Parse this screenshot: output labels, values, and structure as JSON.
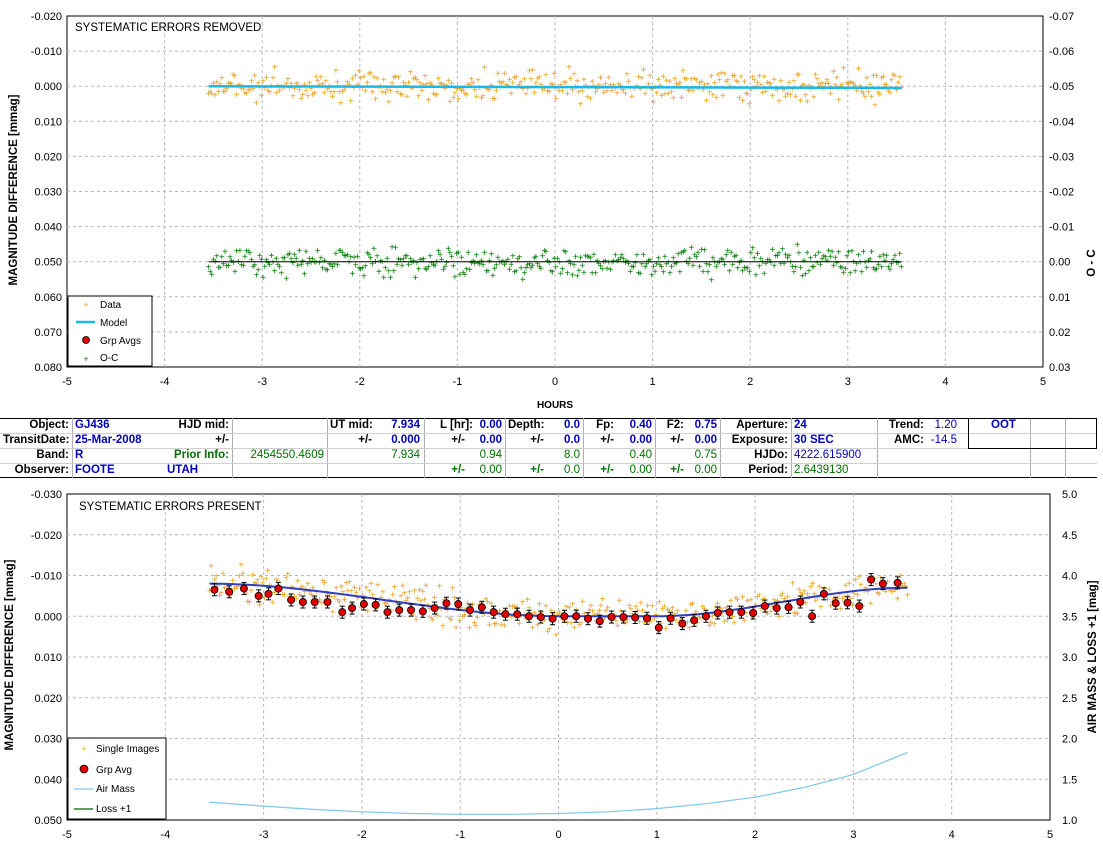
{
  "top_chart": {
    "title": "SYSTEMATIC ERRORS REMOVED",
    "ylabel_left": "MAGNITUDE DIFFERENCE [mmag]",
    "ylabel_right": "O - C",
    "xlabel": "HOURS",
    "x_ticks": [
      "-5",
      "-4",
      "-3",
      "-2",
      "-1",
      "0",
      "1",
      "2",
      "3",
      "4",
      "5"
    ],
    "y_left_ticks": [
      "-0.020",
      "-0.010",
      "0.000",
      "0.010",
      "0.020",
      "0.030",
      "0.040",
      "0.050",
      "0.060",
      "0.070",
      "0.080"
    ],
    "y_right_ticks": [
      "-0.07",
      "-0.06",
      "-0.05",
      "-0.04",
      "-0.03",
      "-0.02",
      "-0.01",
      "0.00",
      "0.01",
      "0.02",
      "0.03"
    ],
    "legend": [
      "Data",
      "Model",
      "Grp Avgs",
      "O-C"
    ]
  },
  "bottom_chart": {
    "title": "SYSTEMATIC ERRORS PRESENT",
    "ylabel_left": "MAGNITUDE DIFFERENCE [mmag]",
    "ylabel_right": "AIR MASS & LOSS +1 [mag]",
    "x_ticks": [
      "-5",
      "-4",
      "-3",
      "-2",
      "-1",
      "0",
      "1",
      "2",
      "3",
      "4",
      "5"
    ],
    "y_left_ticks": [
      "-0.030",
      "-0.020",
      "-0.010",
      "0.000",
      "0.010",
      "0.020",
      "0.030",
      "0.040",
      "0.050"
    ],
    "y_right_ticks": [
      "5.0",
      "4.5",
      "4.0",
      "3.5",
      "3.0",
      "2.5",
      "2.0",
      "1.5",
      "1.0"
    ],
    "legend": [
      "Single Images",
      "Grp Avg",
      "Air Mass",
      "Loss +1"
    ]
  },
  "info": {
    "object_label": "Object:",
    "object": "GJ436",
    "transit_label": "TransitDate:",
    "transit": "25-Mar-2008",
    "band_label": "Band:",
    "band": "R",
    "observer_label": "Observer:",
    "observer": "FOOTE",
    "hjd_mid_label": "HJD mid:",
    "pm1": "+/-",
    "prior_label": "Prior Info:",
    "prior": "2454550.4609",
    "site": "UTAH",
    "ut_mid_label": "UT mid:",
    "ut_mid": "7.934",
    "ut_pm_label": "+/-",
    "ut_pm": "0.000",
    "ut_prior": "7.934",
    "l_label": "L [hr]:",
    "l": "0.00",
    "l_pm_label": "+/-",
    "l_pm": "0.00",
    "l_prior": "0.94",
    "l_pm2_label": "+/-",
    "l_pm2": "0.00",
    "depth_label": "Depth:",
    "depth": "0.0",
    "depth_pm_label": "+/-",
    "depth_pm": "0.0",
    "depth_prior": "8.0",
    "depth_pm2_label": "+/-",
    "depth_pm2": "0.0",
    "fp_label": "Fp:",
    "fp": "0.40",
    "fp_pm_label": "+/-",
    "fp_pm": "0.00",
    "fp_prior": "0.40",
    "fp_pm2_label": "+/-",
    "fp_pm2": "0.00",
    "f2_label": "F2:",
    "f2": "0.75",
    "f2_pm_label": "+/-",
    "f2_pm": "0.00",
    "f2_prior": "0.75",
    "f2_pm2_label": "+/-",
    "f2_pm2": "0.00",
    "aperture_label": "Aperture:",
    "aperture": "24",
    "exposure_label": "Exposure:",
    "exposure": "30 SEC",
    "hjdo_label": "HJDo:",
    "hjdo": "4222.615900",
    "period_label": "Period:",
    "period": "2.6439130",
    "trend_label": "Trend:",
    "trend": "1.20",
    "amc_label": "AMC:",
    "amc": "-14.5",
    "oot": "OOT"
  },
  "colors": {
    "data": "#e8a020",
    "model": "#1ab8e8",
    "oc": "#007a00",
    "grp": "#e00000",
    "airmass": "#7ec8e8",
    "loss": "#006000",
    "trend": "#3040c0"
  },
  "chart_data": [
    {
      "type": "scatter",
      "title": "SYSTEMATIC ERRORS REMOVED",
      "xlabel": "HOURS",
      "ylabel": "MAGNITUDE DIFFERENCE [mmag]",
      "y2label": "O - C",
      "xlim": [
        -5,
        5
      ],
      "ylim": [
        -0.02,
        0.08
      ],
      "y2lim": [
        -0.07,
        0.03
      ],
      "y_inverted": true,
      "grid": true,
      "legend_position": "bottom-left",
      "series": [
        {
          "name": "Data",
          "kind": "points",
          "x_range": [
            -3.55,
            3.55
          ],
          "center": 0.0,
          "scatter": 0.003,
          "count": 420
        },
        {
          "name": "Model",
          "kind": "line",
          "x": [
            -3.55,
            3.55
          ],
          "y": [
            0.0,
            0.0005
          ]
        },
        {
          "name": "O-C",
          "kind": "points",
          "axis": "right",
          "x_range": [
            -3.55,
            3.55
          ],
          "center": 0.0,
          "scatter": 0.003,
          "count": 420
        },
        {
          "name": "O-C zero",
          "kind": "line",
          "axis": "right",
          "x": [
            -3.55,
            3.55
          ],
          "y": [
            0.0,
            0.0
          ]
        }
      ]
    },
    {
      "type": "scatter",
      "title": "SYSTEMATIC ERRORS PRESENT",
      "ylabel": "MAGNITUDE DIFFERENCE [mmag]",
      "y2label": "AIR MASS & LOSS +1 [mag]",
      "xlim": [
        -5,
        5
      ],
      "ylim": [
        -0.03,
        0.05
      ],
      "y2lim": [
        5.0,
        1.0
      ],
      "y_inverted": true,
      "grid": true,
      "legend_position": "bottom-left",
      "series": [
        {
          "name": "Single Images",
          "kind": "points",
          "x_range": [
            -3.55,
            3.55
          ],
          "scatter": 0.003,
          "count": 420
        },
        {
          "name": "Grp Avg",
          "kind": "points",
          "x": [
            -3.5,
            -3.35,
            -3.2,
            -3.05,
            -2.95,
            -2.85,
            -2.72,
            -2.6,
            -2.48,
            -2.35,
            -2.2,
            -2.1,
            -1.98,
            -1.86,
            -1.74,
            -1.62,
            -1.5,
            -1.38,
            -1.26,
            -1.14,
            -1.02,
            -0.9,
            -0.78,
            -0.66,
            -0.54,
            -0.42,
            -0.3,
            -0.18,
            -0.06,
            0.06,
            0.18,
            0.3,
            0.42,
            0.54,
            0.66,
            0.78,
            0.9,
            1.02,
            1.14,
            1.26,
            1.38,
            1.5,
            1.62,
            1.74,
            1.86,
            1.98,
            2.1,
            2.22,
            2.34,
            2.46,
            2.58,
            2.7,
            2.82,
            2.94,
            3.06,
            3.18,
            3.3,
            3.45
          ],
          "y": [
            -0.0065,
            -0.006,
            -0.0068,
            -0.005,
            -0.0055,
            -0.0068,
            -0.004,
            -0.0035,
            -0.0035,
            -0.0035,
            -0.001,
            -0.002,
            -0.003,
            -0.0028,
            -0.001,
            -0.0015,
            -0.0015,
            -0.0012,
            -0.002,
            -0.0032,
            -0.003,
            -0.0015,
            -0.0022,
            -0.001,
            -0.0005,
            -0.0005,
            0.0,
            0.0002,
            0.0006,
            0.0,
            0.0,
            0.0006,
            0.0012,
            0.0002,
            0.0002,
            0.0003,
            0.0005,
            0.0028,
            0.0005,
            0.0018,
            0.001,
            0.0,
            -0.0008,
            -0.001,
            -0.001,
            -0.0008,
            -0.0025,
            -0.002,
            -0.0022,
            -0.0035,
            0.0,
            -0.0055,
            -0.0032,
            -0.0033,
            -0.0025,
            -0.009,
            -0.008,
            -0.0082
          ]
        },
        {
          "name": "Trend model",
          "kind": "line",
          "x": [
            -3.55,
            0.0,
            1.0,
            3.55
          ],
          "y": [
            -0.008,
            0.0,
            0.0,
            -0.007
          ]
        },
        {
          "name": "Air Mass",
          "kind": "line",
          "axis": "right",
          "x": [
            -3.55,
            -3,
            -2.5,
            -2,
            -1.5,
            -1,
            -0.5,
            0,
            0.5,
            1,
            1.5,
            2,
            2.5,
            3,
            3.55
          ],
          "y": [
            1.22,
            1.17,
            1.13,
            1.1,
            1.08,
            1.07,
            1.07,
            1.08,
            1.1,
            1.14,
            1.2,
            1.28,
            1.4,
            1.56,
            1.83
          ]
        },
        {
          "name": "Loss +1",
          "kind": "line",
          "axis": "right",
          "x": [],
          "y": []
        }
      ]
    }
  ]
}
